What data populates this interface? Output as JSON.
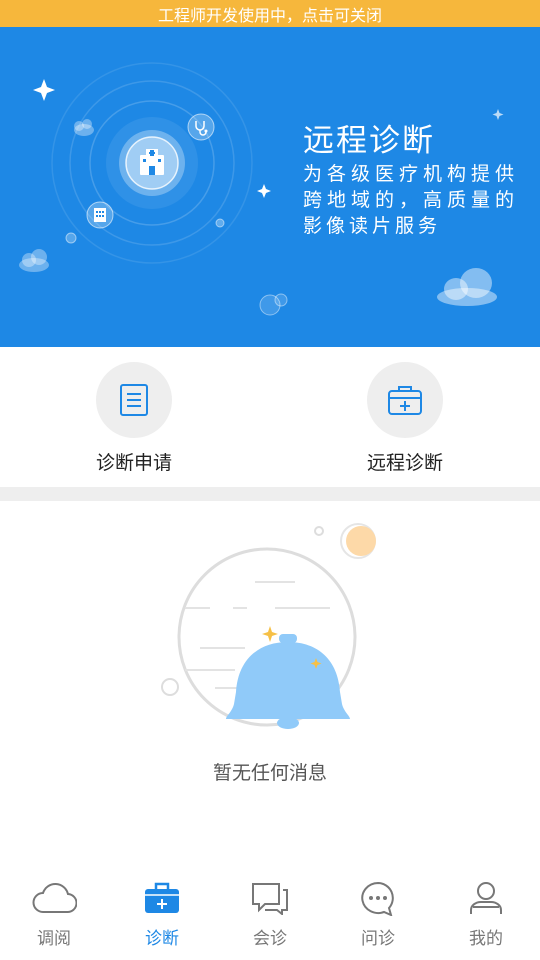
{
  "dev_banner": {
    "text": "工程师开发使用中，点击可关闭"
  },
  "hero": {
    "title": "远程诊断",
    "description": "为各级医疗机构提供跨地域的，高质量的影像读片服务"
  },
  "services": [
    {
      "label": "诊断申请",
      "icon": "document-icon"
    },
    {
      "label": "远程诊断",
      "icon": "medical-kit-icon"
    }
  ],
  "empty_state": {
    "text": "暂无任何消息",
    "icon": "bell-icon"
  },
  "tabs": [
    {
      "label": "调阅",
      "icon": "cloud-icon",
      "active": false
    },
    {
      "label": "诊断",
      "icon": "medical-kit-icon",
      "active": true
    },
    {
      "label": "会诊",
      "icon": "chat-bubbles-icon",
      "active": false
    },
    {
      "label": "问诊",
      "icon": "chat-dots-icon",
      "active": false
    },
    {
      "label": "我的",
      "icon": "user-icon",
      "active": false
    }
  ],
  "colors": {
    "dev_banner_bg": "#F6B73C",
    "hero_bg": "#1E88E5",
    "accent": "#1E88E5",
    "tab_inactive": "#777777",
    "empty_bell": "#90CAF9"
  }
}
